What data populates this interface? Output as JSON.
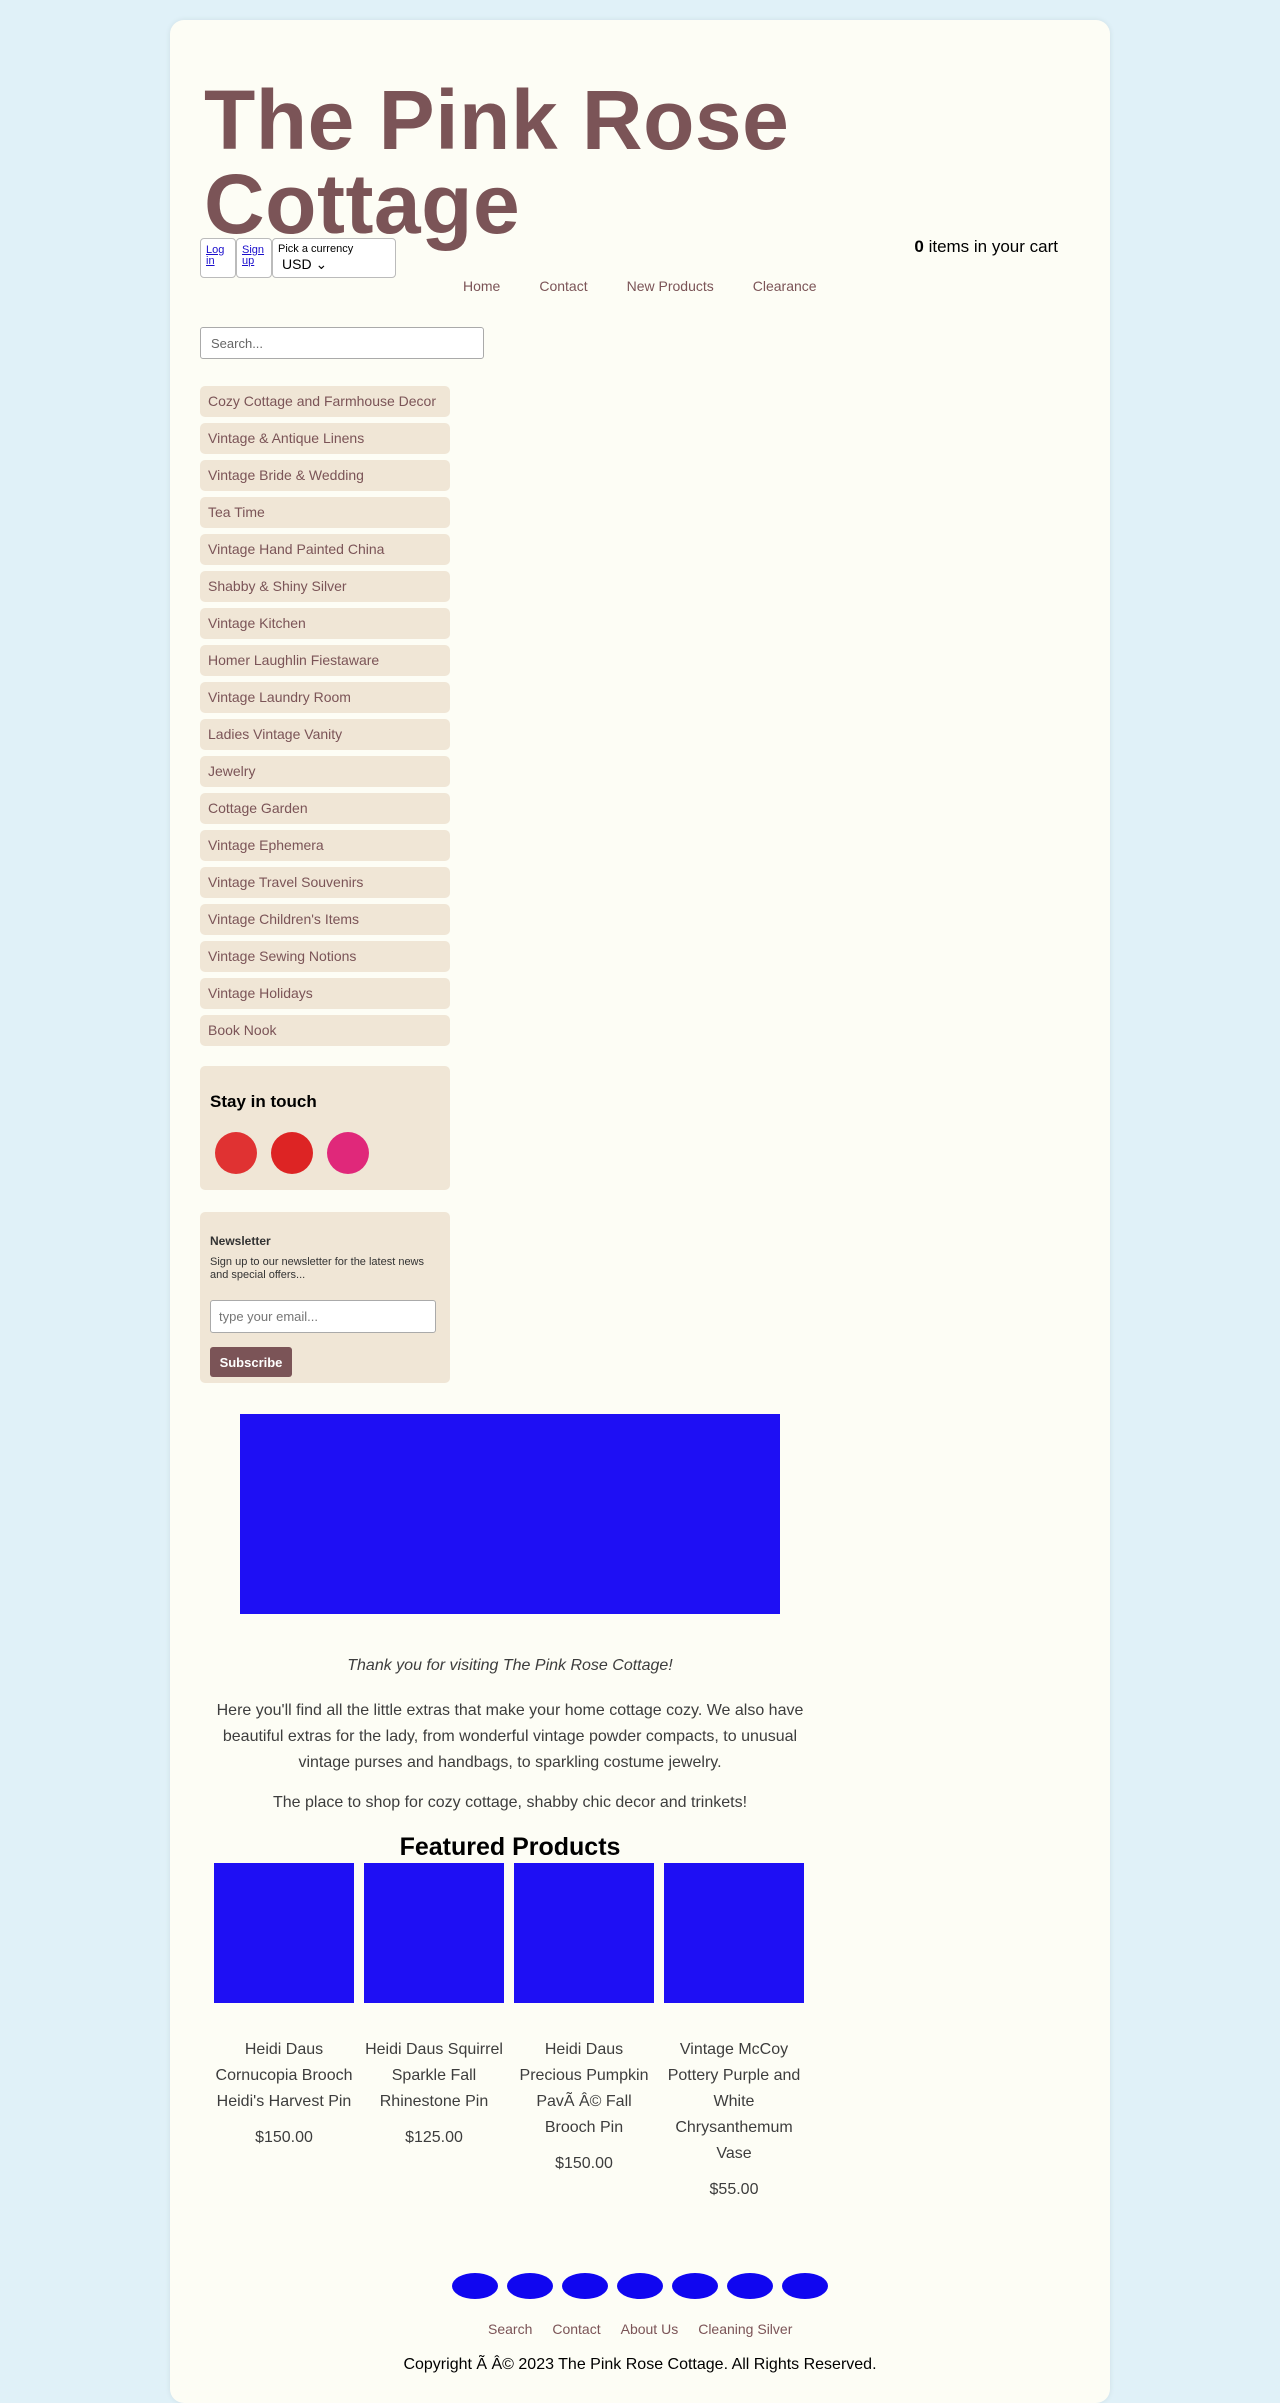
{
  "header": {
    "site_title": "The Pink Rose Cottage",
    "login_label": "Log in",
    "signup_label": "Sign up",
    "currency_label": "Pick a currency",
    "currency_value": "USD",
    "cart_count": "0",
    "cart_text": "items in your cart"
  },
  "nav": {
    "items": [
      "Home",
      "Contact",
      "New Products",
      "Clearance"
    ]
  },
  "sidebar": {
    "search_placeholder": "Search...",
    "categories": [
      "Cozy Cottage and Farmhouse Decor",
      "Vintage & Antique Linens",
      "Vintage Bride & Wedding",
      "Tea Time",
      "Vintage Hand Painted China",
      "Shabby & Shiny Silver",
      "Vintage Kitchen",
      "Homer Laughlin Fiestaware",
      "Vintage Laundry Room",
      "Ladies Vintage Vanity",
      "Jewelry",
      "Cottage Garden",
      "Vintage Ephemera",
      "Vintage Travel Souvenirs",
      "Vintage Children's Items",
      "Vintage Sewing Notions",
      "Vintage Holidays",
      "Book Nook"
    ],
    "stay_in_touch": "Stay in touch",
    "social_icons": [
      {
        "icon": "social-icon-1",
        "color": "#e03232"
      },
      {
        "icon": "social-icon-2",
        "color": "#dd2424"
      },
      {
        "icon": "social-icon-3",
        "color": "#e0287a"
      }
    ],
    "newsletter": {
      "title": "Newsletter",
      "text": "Sign up to our newsletter for the latest news and special offers...",
      "placeholder": "type your email...",
      "button": "Subscribe"
    }
  },
  "main": {
    "thanks": "Thank you for visiting The Pink Rose Cottage!",
    "intro": "Here you'll find all the little extras that make your home cottage cozy. We also have beautiful extras for the lady, from wonderful vintage powder compacts, to unusual vintage purses and handbags, to sparkling costume jewelry.",
    "tagline": "The place to shop for cozy cottage, shabby chic decor and trinkets!",
    "featured_title": "Featured Products",
    "products": [
      {
        "name": "Heidi Daus Cornucopia Brooch Heidi's Harvest Pin",
        "price": "$150.00"
      },
      {
        "name": "Heidi Daus Squirrel Sparkle Fall Rhinestone Pin",
        "price": "$125.00"
      },
      {
        "name": "Heidi Daus Precious Pumpkin PavÃ   Â© Fall Brooch Pin",
        "price": "$150.00"
      },
      {
        "name": "Vintage McCoy Pottery Purple and White Chrysanthemum Vase",
        "price": "$55.00"
      }
    ]
  },
  "footer": {
    "links": [
      "Search",
      "Contact",
      "About Us",
      "Cleaning Silver"
    ],
    "copyright": "Copyright Ã   Â© 2023 The Pink Rose Cottage. All Rights Reserved."
  },
  "colors": {
    "brand": "#7b5457",
    "sidebar_bg": "#f0e6d6",
    "image_placeholder": "#1e0ff4"
  }
}
